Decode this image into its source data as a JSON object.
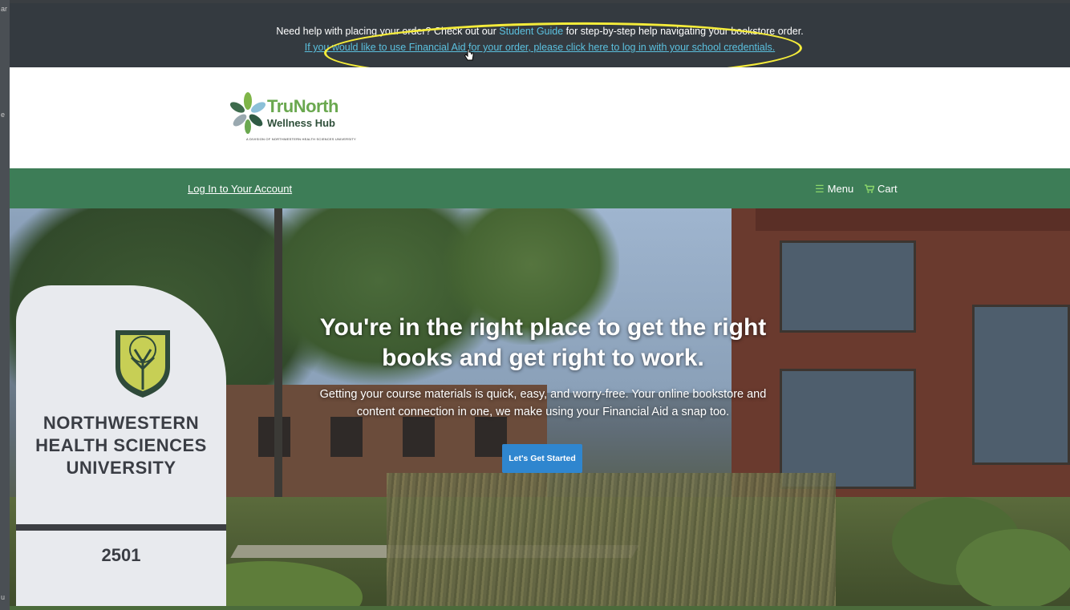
{
  "side_labels": {
    "top": "ar",
    "mid": "e",
    "bottom": "u"
  },
  "notice": {
    "line1_before": "Need help with placing your order? Check out our ",
    "line1_link": "Student Guide",
    "line1_after": " for step-by-step help navigating your bookstore order.",
    "line2_link": "If you would like to use Financial Aid for your order, please click here to log in with your school credentials."
  },
  "brand": {
    "logo_word1": "TruNorth",
    "logo_word2": "Wellness Hub",
    "logo_tagline": "A DIVISION OF NORTHWESTERN HEALTH SCIENCES UNIVERSITY"
  },
  "nav": {
    "login": "Log In to Your Account",
    "menu": "Menu",
    "cart": "Cart"
  },
  "hero": {
    "headline": "You're in the right place to get the right books and get right to work.",
    "body": "Getting your course materials is quick, easy, and worry-free. Your online bookstore and content connection in one, we make using your Financial Aid a snap too.",
    "cta": "Let's Get Started"
  },
  "sign": {
    "line1": "NORTHWESTERN",
    "line2": "HEALTH SCIENCES",
    "line3": "UNIVERSITY",
    "number": "2501"
  },
  "colors": {
    "notice_bg": "#343a40",
    "link": "#5bc0de",
    "nav_bg": "#3d7d57",
    "cta_bg": "#2f86cf",
    "highlight": "#f5ec3a"
  },
  "icons": {
    "menu": "hamburger-icon",
    "cart": "cart-icon",
    "cursor": "hand-pointer-icon"
  }
}
